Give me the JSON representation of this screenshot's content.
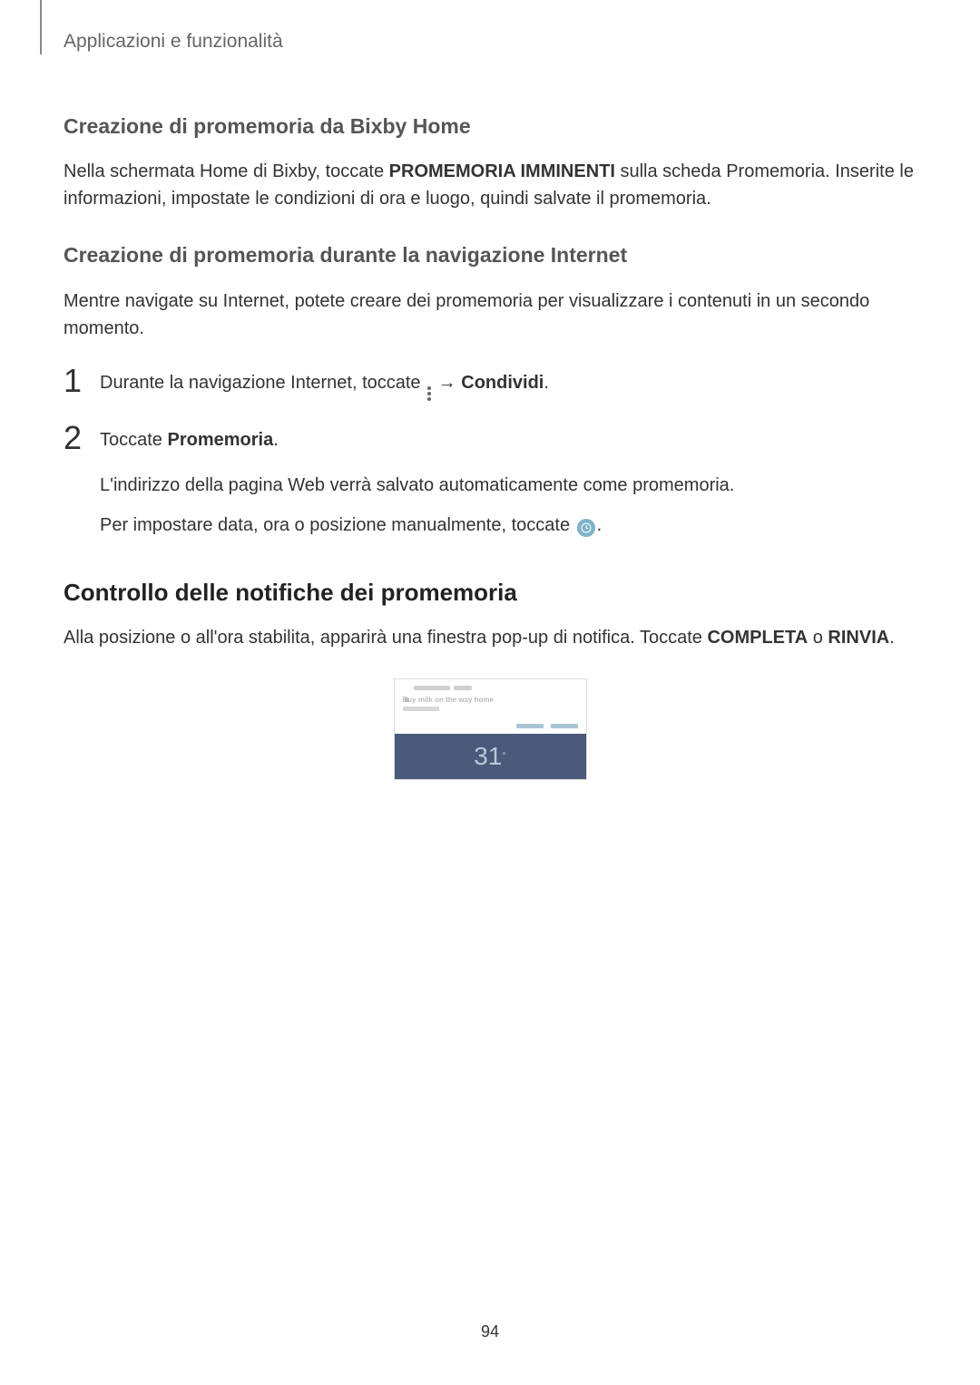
{
  "chapter": "Applicazioni e funzionalità",
  "section1": {
    "title": "Creazione di promemoria da Bixby Home",
    "text_before": "Nella schermata Home di Bixby, toccate ",
    "text_bold": "PROMEMORIA IMMINENTI",
    "text_after": " sulla scheda Promemoria. Inserite le informazioni, impostate le condizioni di ora e luogo, quindi salvate il promemoria."
  },
  "section2": {
    "title": "Creazione di promemoria durante la navigazione Internet",
    "intro": "Mentre navigate su Internet, potete creare dei promemoria per visualizzare i contenuti in un secondo momento.",
    "step1_before": "Durante la navigazione Internet, toccate ",
    "step1_arrow": " → ",
    "step1_bold": "Condividi",
    "step1_after": ".",
    "step2_before": "Toccate ",
    "step2_bold": "Promemoria",
    "step2_after": ".",
    "step2_sub1": "L'indirizzo della pagina Web verrà salvato automaticamente come promemoria.",
    "step2_sub2_before": "Per impostare data, ora o posizione manualmente, toccate ",
    "step2_sub2_after": "."
  },
  "section3": {
    "title": "Controllo delle notifiche dei promemoria",
    "text_before": "Alla posizione o all'ora stabilita, apparirà una finestra pop-up di notifica. Toccate ",
    "text_bold1": "COMPLETA",
    "text_mid": " o ",
    "text_bold2": "RINVIA",
    "text_after": "."
  },
  "screenshot": {
    "title": "Buy milk on the way home",
    "weather_num": "31"
  },
  "page_number": "94"
}
